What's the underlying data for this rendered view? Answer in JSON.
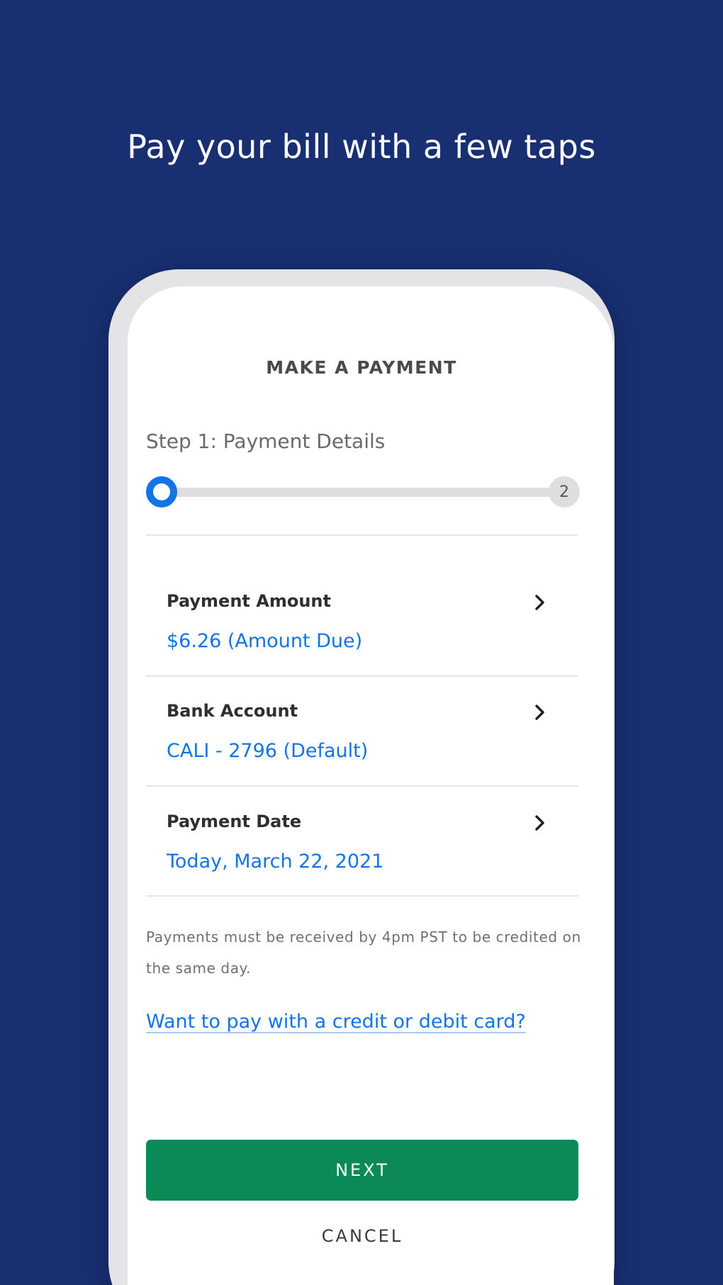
{
  "promo": {
    "headline": "Pay your bill with a few taps"
  },
  "screen": {
    "title": "MAKE A PAYMENT",
    "step_title": "Step 1: Payment Details",
    "progress": {
      "current_step": 1,
      "total_steps": 2,
      "fraction_complete": 0,
      "step2_label": "2"
    },
    "details": [
      {
        "label": "Payment Amount",
        "value": "$6.26 (Amount Due)",
        "icon": "chevron-right-icon"
      },
      {
        "label": "Bank Account",
        "value": "CALI - 2796 (Default)",
        "icon": "chevron-right-icon"
      },
      {
        "label": "Payment Date",
        "value": "Today, March 22, 2021",
        "icon": "chevron-right-icon"
      }
    ],
    "note": "Payments must be received by 4pm PST to be credited on the same day.",
    "card_link": "Want to pay with a credit or debit card?",
    "next_label": "NEXT",
    "cancel_label": "CANCEL"
  },
  "colors": {
    "background": "#182f71",
    "accent_blue": "#1473e6",
    "primary_green": "#0b8a57"
  }
}
